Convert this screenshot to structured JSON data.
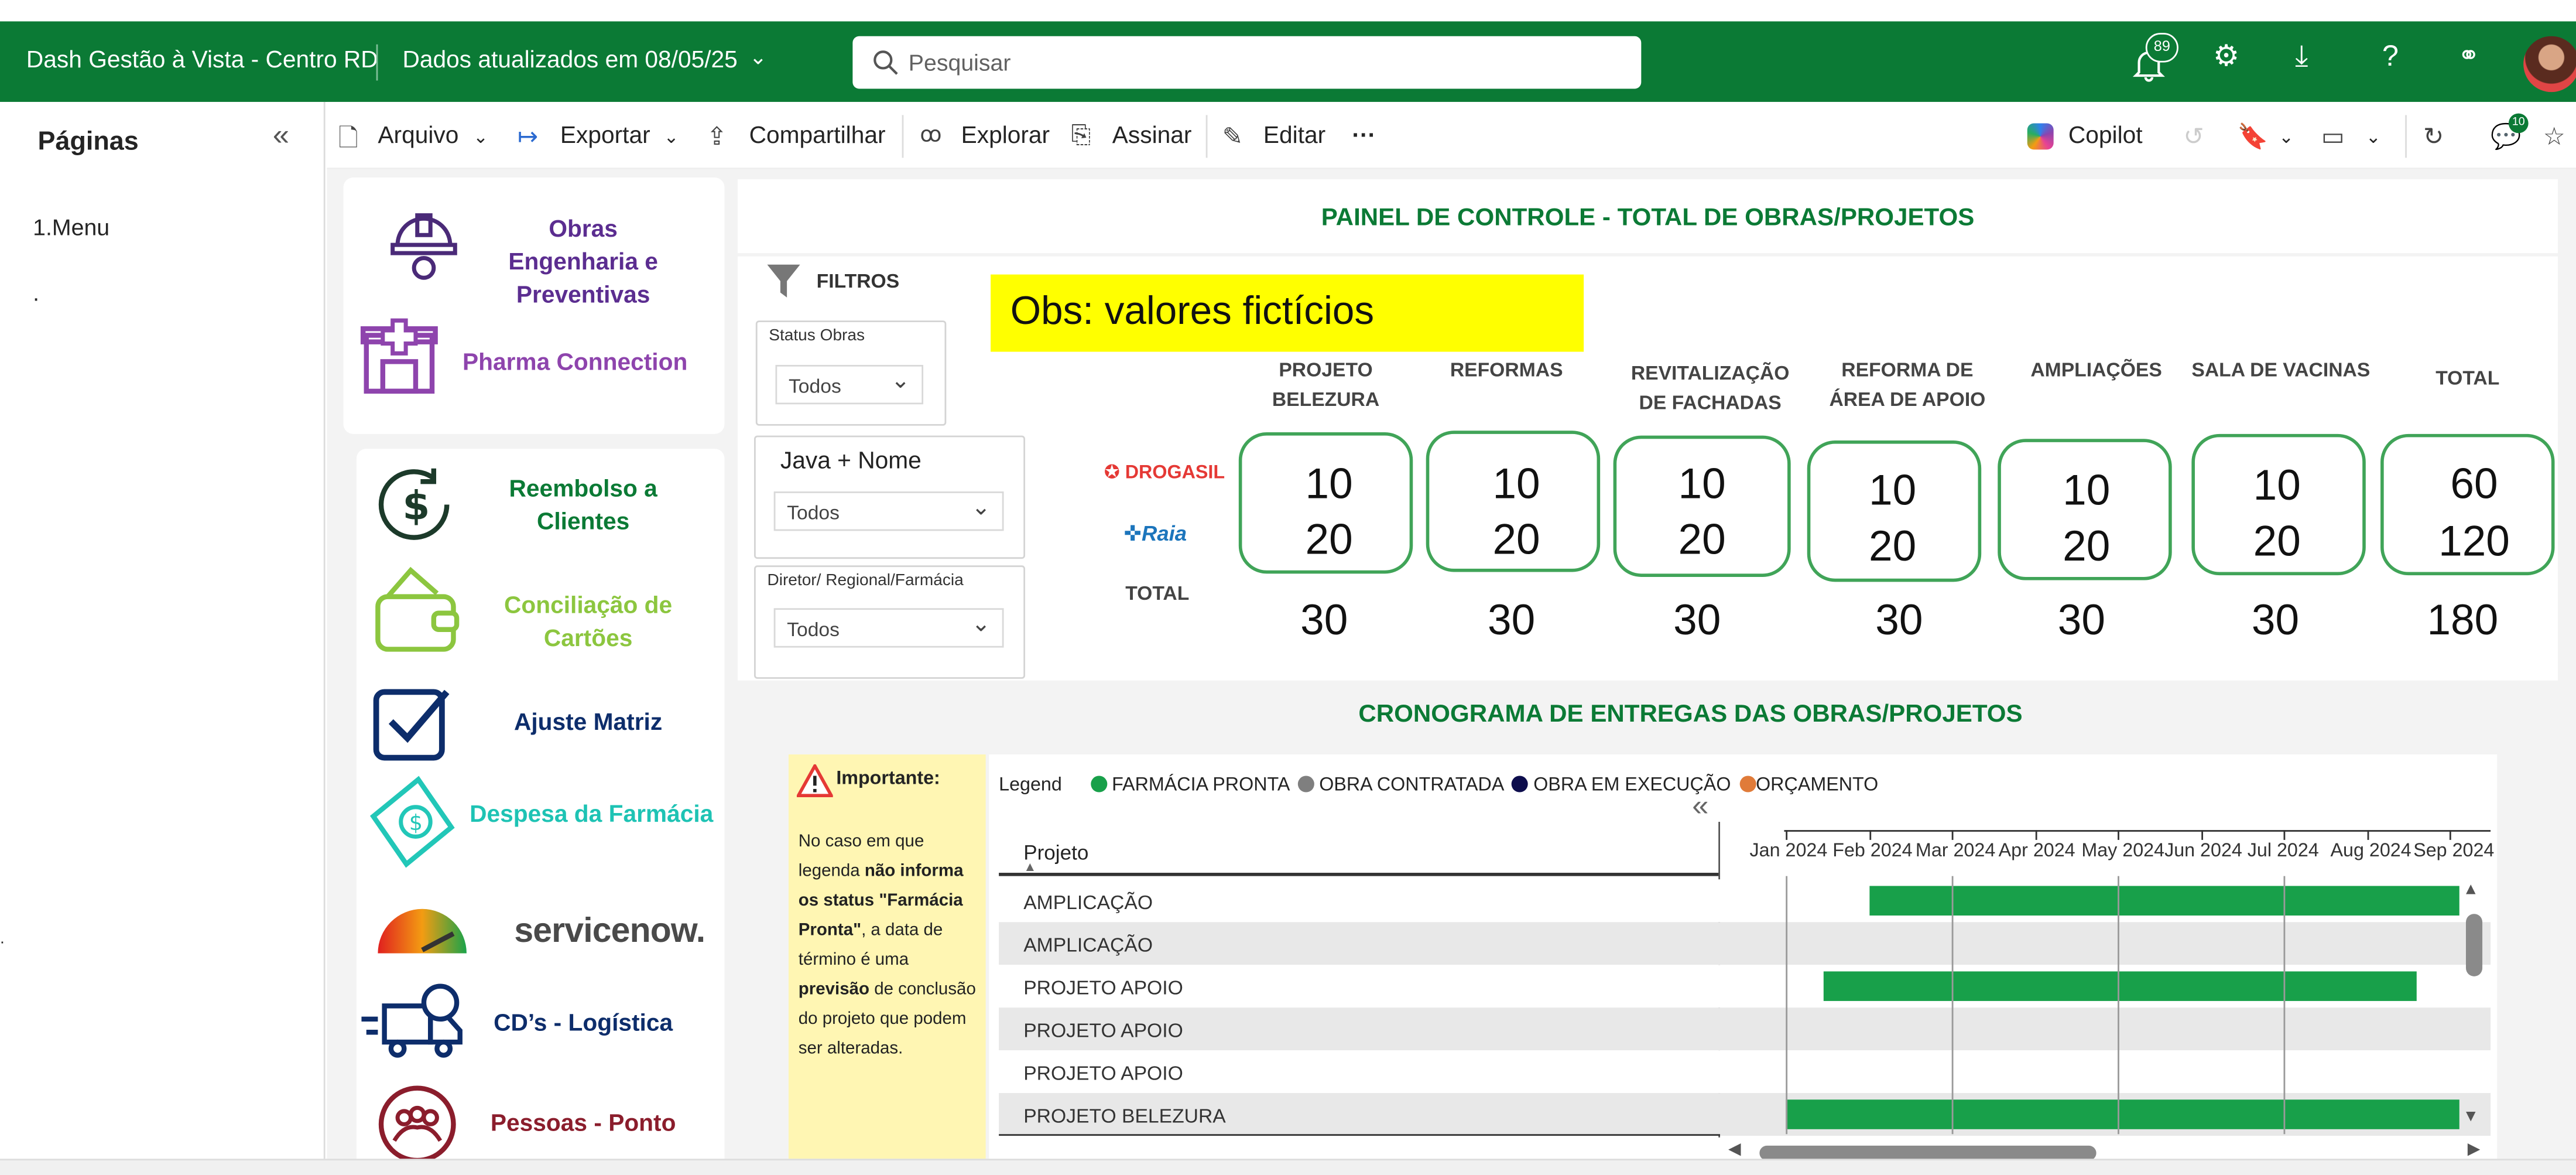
{
  "appbar": {
    "title": "Dash Gestão à Vista - Centro RD",
    "updated": "Dados atualizados em 08/05/25",
    "search_placeholder": "Pesquisar",
    "notif_count": "89",
    "brand_color": "#0b7a35"
  },
  "pages": {
    "title": "Páginas",
    "items": [
      "1.Menu",
      "."
    ],
    "stray_dot": "."
  },
  "toolbar": {
    "arquivo": "Arquivo",
    "exportar": "Exportar",
    "compartilhar": "Compartilhar",
    "explorar": "Explorar",
    "assinar": "Assinar",
    "editar": "Editar",
    "more": "···",
    "copilot": "Copilot",
    "comment_count": "10"
  },
  "menu": {
    "obras": "Obras Engenharia e Preventivas",
    "pharma": "Pharma Connection",
    "reembolso": "Reembolso a Clientes",
    "conciliacao": "Conciliação de Cartões",
    "ajuste": "Ajuste Matriz",
    "despesa": "Despesa da Farmácia",
    "servicenow": "servicenow.",
    "cds": "CD’s - Logística",
    "pessoas": "Pessoas - Ponto"
  },
  "painel": {
    "title": "PAINEL DE CONTROLE - TOTAL DE OBRAS/PROJETOS",
    "obs": "Obs: valores fictícios",
    "filters_title": "FILTROS",
    "filters": [
      {
        "label": "Status Obras",
        "value": "Todos"
      },
      {
        "label": "Java + Nome",
        "value": "Todos"
      },
      {
        "label": "Diretor/ Regional/Farmácia",
        "value": "Todos"
      }
    ],
    "rows": {
      "drogasil": "DROGASIL",
      "raia": "Raia",
      "total": "TOTAL"
    },
    "columns": [
      {
        "header": "PROJETO BELEZURA",
        "drogasil": "10",
        "raia": "20",
        "total": "30"
      },
      {
        "header": "REFORMAS",
        "drogasil": "10",
        "raia": "20",
        "total": "30"
      },
      {
        "header": "REVITALIZAÇÃO DE FACHADAS",
        "drogasil": "10",
        "raia": "20",
        "total": "30"
      },
      {
        "header": "REFORMA DE ÁREA DE APOIO",
        "drogasil": "10",
        "raia": "20",
        "total": "30"
      },
      {
        "header": "AMPLIAÇÕES",
        "drogasil": "10",
        "raia": "20",
        "total": "30"
      },
      {
        "header": "SALA DE VACINAS",
        "drogasil": "10",
        "raia": "20",
        "total": "30"
      },
      {
        "header": "TOTAL",
        "drogasil": "60",
        "raia": "120",
        "total": "180"
      }
    ]
  },
  "cronograma": {
    "title": "CRONOGRAMA DE ENTREGAS DAS OBRAS/PROJETOS",
    "note_title": "Importante:",
    "note_pre": "No caso em que legenda ",
    "note_b1": "não informa os status \"Farmácia Pronta\"",
    "note_mid": ", a data de término é uma ",
    "note_b2": "previsão",
    "note_post": " de conclusão do projeto que podem ser alteradas.",
    "legend_label": "Legend",
    "legend": [
      {
        "name": "FARMÁCIA PRONTA",
        "color": "#18a04a"
      },
      {
        "name": "OBRA CONTRATADA",
        "color": "#7f7f7f"
      },
      {
        "name": "OBRA EM EXECUÇÃO",
        "color": "#0d0d4d"
      },
      {
        "name": "ORÇAMENTO",
        "color": "#e07b39"
      }
    ],
    "col_header": "Projeto",
    "months": [
      "Jan 2024",
      "Feb 2024",
      "Mar 2024",
      "Apr 2024",
      "May 2024",
      "Jun 2024",
      "Jul 2024",
      "Aug 2024",
      "Sep 2024"
    ],
    "rows": [
      {
        "name": "AMPLICAÇÃO",
        "start": "2024-02-01",
        "end": "2024-09-30"
      },
      {
        "name": "AMPLICAÇÃO",
        "start": null,
        "end": null
      },
      {
        "name": "PROJETO APOIO",
        "start": "2024-01-15",
        "end": "2024-08-20"
      },
      {
        "name": "PROJETO APOIO",
        "start": null,
        "end": null
      },
      {
        "name": "PROJETO APOIO",
        "start": null,
        "end": null
      },
      {
        "name": "PROJETO BELEZURA",
        "start": "2024-01-01",
        "end": "2024-09-30"
      }
    ]
  }
}
